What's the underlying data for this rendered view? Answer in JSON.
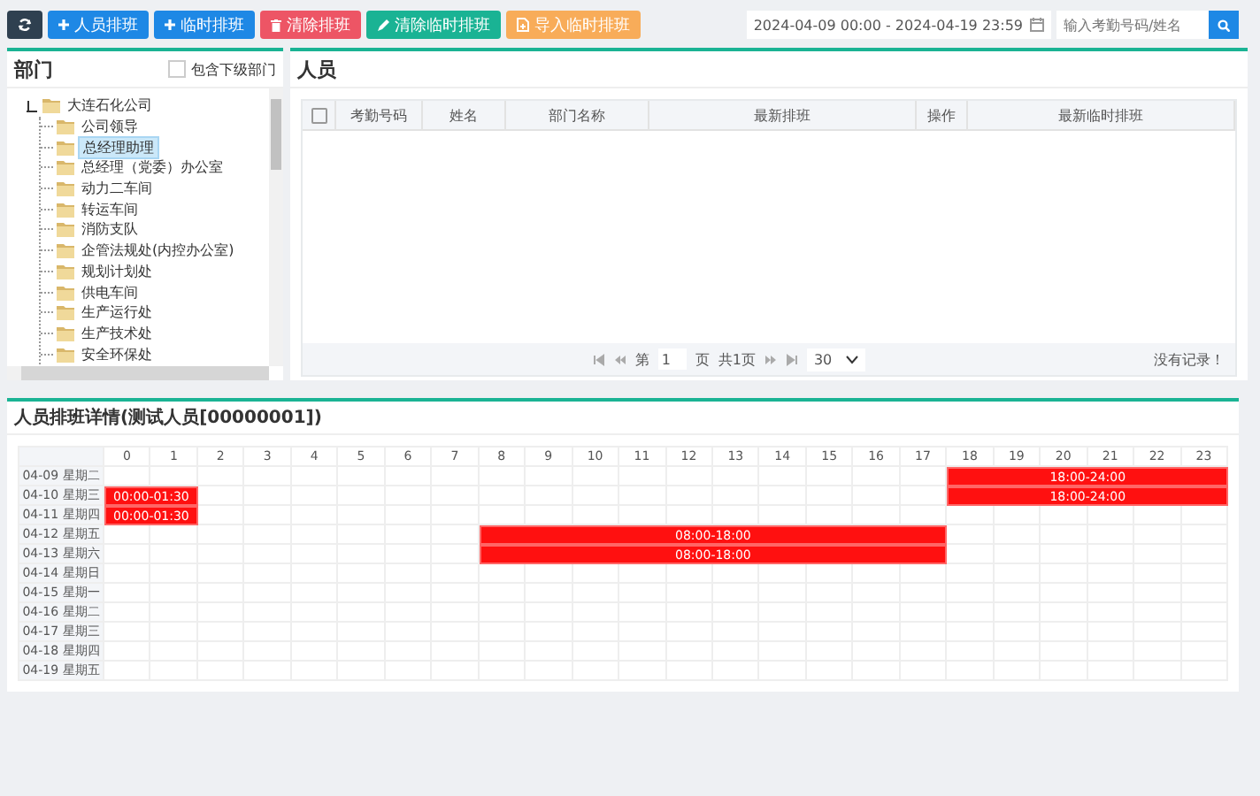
{
  "toolbar": {
    "buttons": [
      {
        "kind": "refresh"
      },
      {
        "kind": "add",
        "label": "人员排班"
      },
      {
        "kind": "add",
        "label": "临时排班"
      },
      {
        "kind": "delete",
        "label": "清除排班"
      },
      {
        "kind": "clear",
        "label": "清除临时排班"
      },
      {
        "kind": "import",
        "label": "导入临时排班"
      }
    ],
    "date_range": "2024-04-09 00:00 - 2024-04-19 23:59",
    "search": {
      "placeholder": "输入考勤号码/姓名"
    }
  },
  "departments": {
    "title": "部门",
    "include_sub": {
      "label": "包含下级部门",
      "checked": false
    },
    "tree": [
      {
        "label": "大连石化公司",
        "expanded": true,
        "selected": false,
        "children": [
          {
            "label": "公司领导",
            "selected": false
          },
          {
            "label": "总经理助理",
            "selected": true
          },
          {
            "label": "总经理（党委）办公室",
            "selected": false
          },
          {
            "label": "动力二车间",
            "selected": false
          },
          {
            "label": "转运车间",
            "selected": false
          },
          {
            "label": "消防支队",
            "selected": false
          },
          {
            "label": "企管法规处(内控办公室)",
            "selected": false
          },
          {
            "label": "规划计划处",
            "selected": false
          },
          {
            "label": "供电车间",
            "selected": false
          },
          {
            "label": "生产运行处",
            "selected": false
          },
          {
            "label": "生产技术处",
            "selected": false
          },
          {
            "label": "安全环保处",
            "selected": false
          }
        ]
      }
    ]
  },
  "people": {
    "title": "人员",
    "select_all_checked": false,
    "columns": [
      "考勤号码",
      "姓名",
      "部门名称",
      "最新排班",
      "操作",
      "最新临时排班"
    ],
    "pager": {
      "page_prefix": "第",
      "page": "1",
      "page_suffix": "页",
      "total": "共1页",
      "page_size": "30",
      "empty": "没有记录！"
    }
  },
  "schedule": {
    "title": "人员排班详情(测试人员[00000001])",
    "hours": [
      "0",
      "1",
      "2",
      "3",
      "4",
      "5",
      "6",
      "7",
      "8",
      "9",
      "10",
      "11",
      "12",
      "13",
      "14",
      "15",
      "16",
      "17",
      "18",
      "19",
      "20",
      "21",
      "22",
      "23"
    ],
    "rows": [
      {
        "day": "04-09 星期二",
        "shifts": [
          {
            "label": "18:00-24:00"
          }
        ]
      },
      {
        "day": "04-10 星期三",
        "shifts": [
          {
            "label": "00:00-01:30"
          },
          {
            "label": "18:00-24:00"
          }
        ]
      },
      {
        "day": "04-11 星期四",
        "shifts": [
          {
            "label": "00:00-01:30"
          }
        ]
      },
      {
        "day": "04-12 星期五",
        "shifts": [
          {
            "label": "08:00-18:00"
          }
        ]
      },
      {
        "day": "04-13 星期六",
        "shifts": [
          {
            "label": "08:00-18:00"
          }
        ]
      },
      {
        "day": "04-14 星期日",
        "shifts": []
      },
      {
        "day": "04-15 星期一",
        "shifts": []
      },
      {
        "day": "04-16 星期二",
        "shifts": []
      },
      {
        "day": "04-17 星期三",
        "shifts": []
      },
      {
        "day": "04-18 星期四",
        "shifts": []
      },
      {
        "day": "04-19 星期五",
        "shifts": []
      }
    ]
  }
}
